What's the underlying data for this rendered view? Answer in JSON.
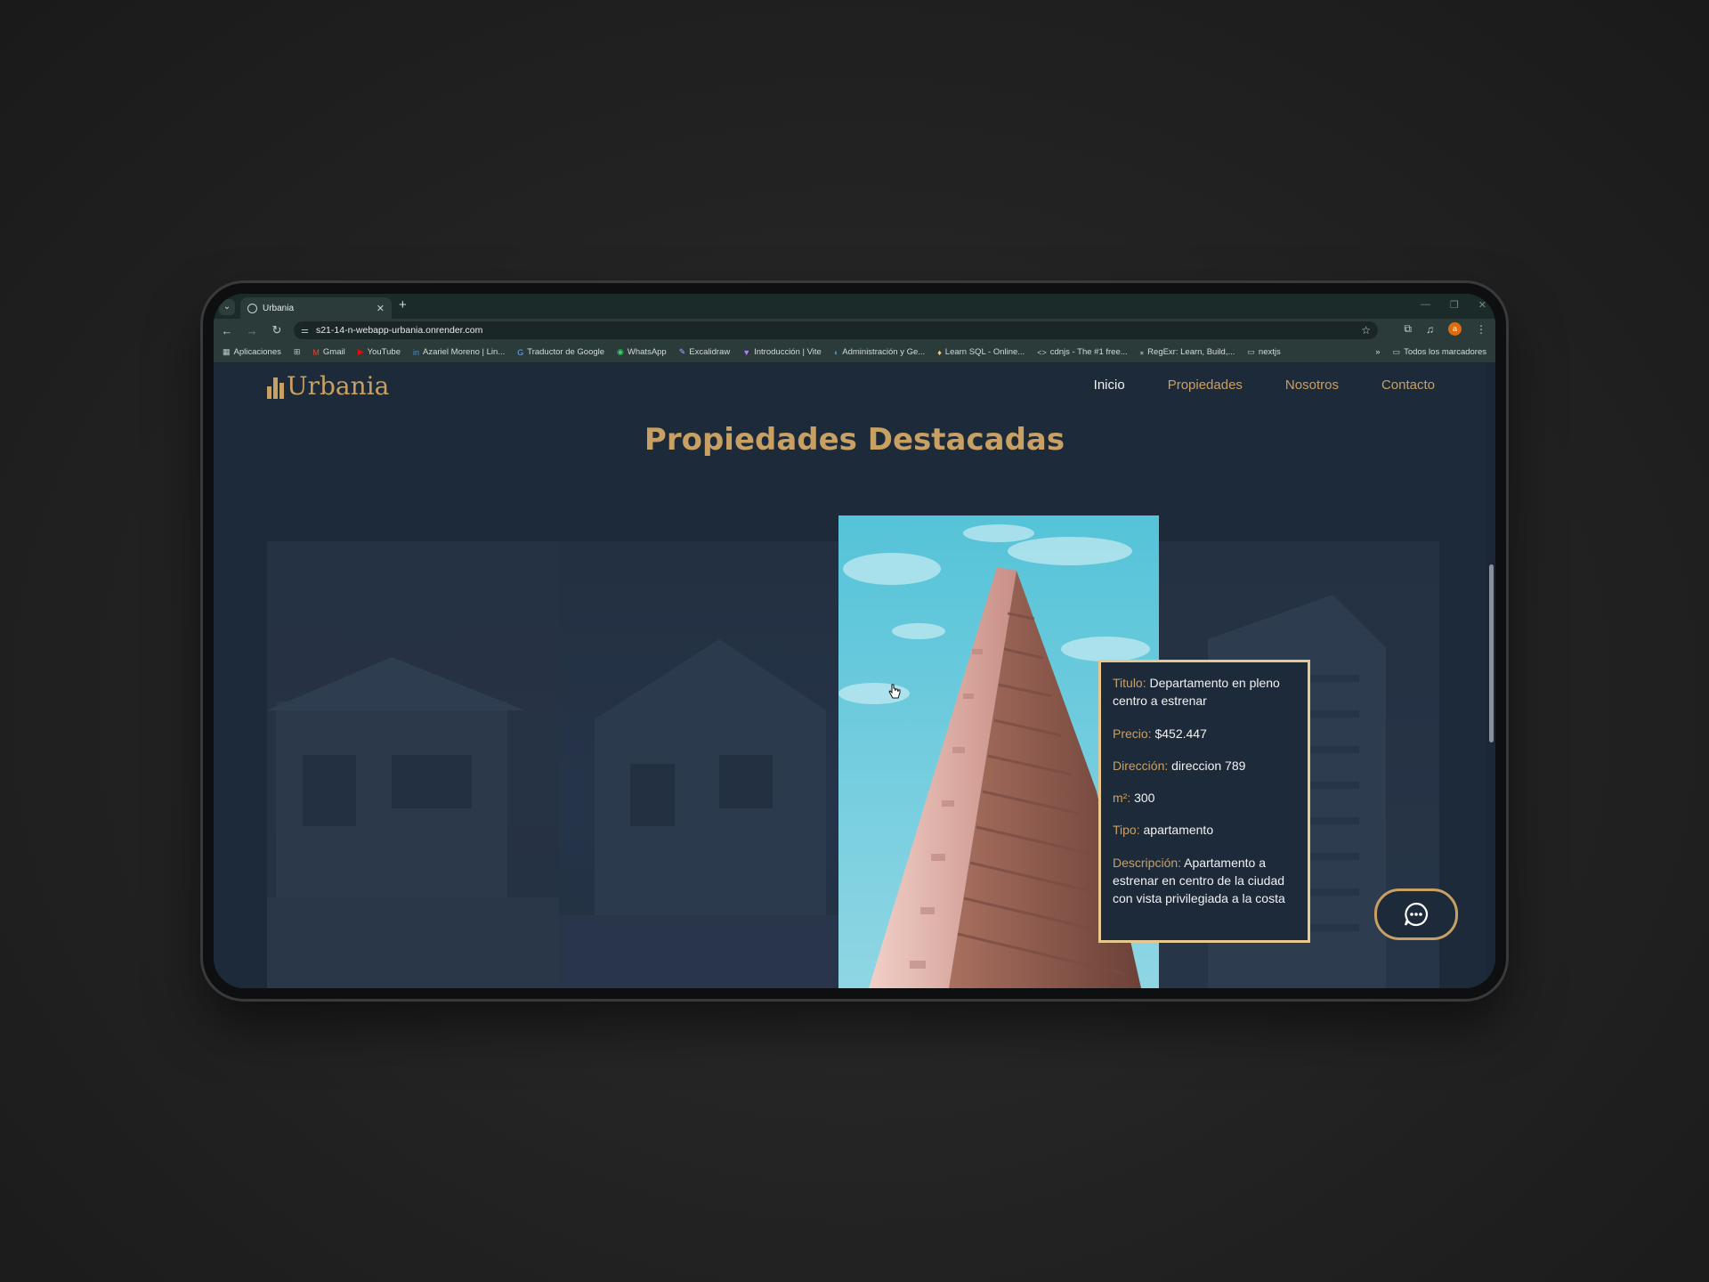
{
  "browser": {
    "tab_title": "Urbania",
    "url": "s21-14-n-webapp-urbania.onrender.com",
    "bookmarks": [
      {
        "label": "Aplicaciones",
        "icon": "apps-grid-icon"
      },
      {
        "label": "Gmail",
        "icon": "gmail-icon"
      },
      {
        "label": "YouTube",
        "icon": "youtube-icon"
      },
      {
        "label": "Azariel Moreno | Lin...",
        "icon": "linkedin-icon"
      },
      {
        "label": "Traductor de Google",
        "icon": "translate-icon"
      },
      {
        "label": "WhatsApp",
        "icon": "whatsapp-icon"
      },
      {
        "label": "Excalidraw",
        "icon": "excalidraw-icon"
      },
      {
        "label": "Introducción | Vite",
        "icon": "vite-icon"
      },
      {
        "label": "Administración y Ge...",
        "icon": "edge-icon"
      },
      {
        "label": "Learn SQL - Online...",
        "icon": "bulb-icon"
      },
      {
        "label": "cdnjs - The #1 free...",
        "icon": "code-icon"
      },
      {
        "label": "RegExr: Learn, Build,...",
        "icon": "regex-icon"
      },
      {
        "label": "nextjs",
        "icon": "folder-icon"
      }
    ],
    "all_bookmarks": "Todos los marcadores",
    "profile_initial": "a"
  },
  "site": {
    "brand": "Urbania",
    "nav": [
      "Inicio",
      "Propiedades",
      "Nosotros",
      "Contacto"
    ],
    "section_title": "Propiedades Destacadas"
  },
  "property": {
    "titulo_label": "Titulo:",
    "titulo": "Departamento en pleno centro a estrenar",
    "precio_label": "Precio:",
    "precio": "$452.447",
    "direccion_label": "Dirección:",
    "direccion": "direccion 789",
    "m2_label": "m²:",
    "m2": "300",
    "tipo_label": "Tipo:",
    "tipo": "apartamento",
    "descripcion_label": "Descripción:",
    "descripcion": "Apartamento a estrenar en centro de la ciudad con vista privilegiada a la costa"
  },
  "colors": {
    "accent": "#c9a063",
    "page_bg": "#1d2a3a",
    "card_border": "#e8c88e"
  }
}
